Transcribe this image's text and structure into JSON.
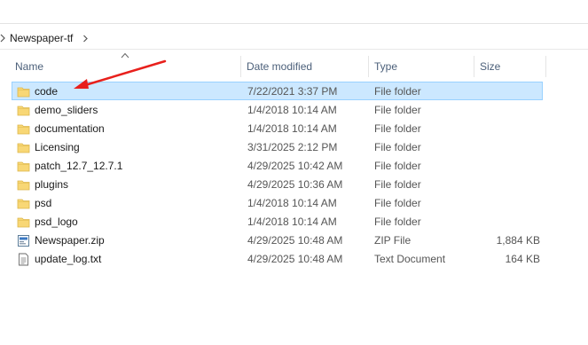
{
  "breadcrumb": {
    "folder": "Newspaper-tf"
  },
  "columns": {
    "name": "Name",
    "date_modified": "Date modified",
    "type": "Type",
    "size": "Size"
  },
  "files": [
    {
      "name": "code",
      "date": "7/22/2021 3:37 PM",
      "type": "File folder",
      "size": "",
      "icon": "folder-icon",
      "selected": true
    },
    {
      "name": "demo_sliders",
      "date": "1/4/2018 10:14 AM",
      "type": "File folder",
      "size": "",
      "icon": "folder-icon"
    },
    {
      "name": "documentation",
      "date": "1/4/2018 10:14 AM",
      "type": "File folder",
      "size": "",
      "icon": "folder-icon"
    },
    {
      "name": "Licensing",
      "date": "3/31/2025 2:12 PM",
      "type": "File folder",
      "size": "",
      "icon": "folder-icon"
    },
    {
      "name": "patch_12.7_12.7.1",
      "date": "4/29/2025 10:42 AM",
      "type": "File folder",
      "size": "",
      "icon": "folder-icon"
    },
    {
      "name": "plugins",
      "date": "4/29/2025 10:36 AM",
      "type": "File folder",
      "size": "",
      "icon": "folder-icon"
    },
    {
      "name": "psd",
      "date": "1/4/2018 10:14 AM",
      "type": "File folder",
      "size": "",
      "icon": "folder-icon"
    },
    {
      "name": "psd_logo",
      "date": "1/4/2018 10:14 AM",
      "type": "File folder",
      "size": "",
      "icon": "folder-icon"
    },
    {
      "name": "Newspaper.zip",
      "date": "4/29/2025 10:48 AM",
      "type": "ZIP File",
      "size": "1,884 KB",
      "icon": "zip-file-icon"
    },
    {
      "name": "update_log.txt",
      "date": "4/29/2025 10:48 AM",
      "type": "Text Document",
      "size": "164 KB",
      "icon": "text-file-icon"
    }
  ],
  "colors": {
    "selection_bg": "#cce8ff",
    "selection_border": "#99d1ff",
    "annotation_arrow": "#e8201c",
    "folder": "#f8d775"
  }
}
